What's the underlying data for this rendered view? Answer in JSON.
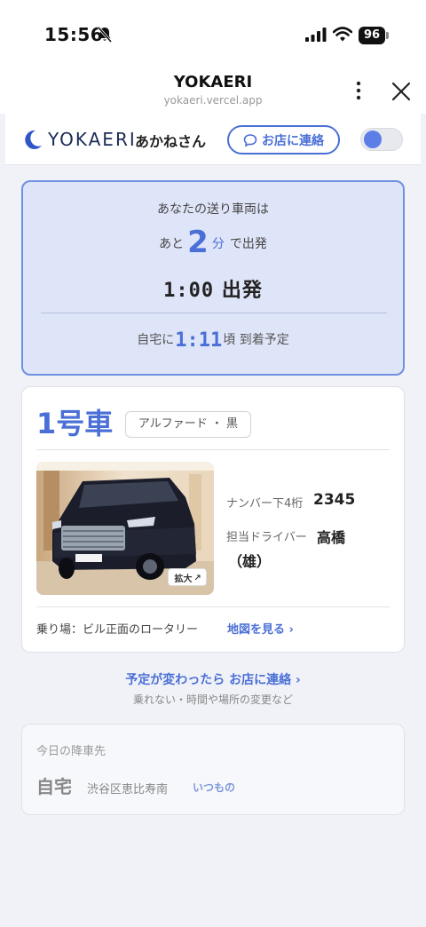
{
  "status_bar": {
    "time": "15:56",
    "battery": "96",
    "icons": [
      "bell-slash-icon",
      "signal-icon",
      "wifi-icon",
      "battery-icon"
    ]
  },
  "browser": {
    "title": "YOKAERI",
    "url": "yokaeri.vercel.app",
    "icons": [
      "more-vertical-icon",
      "close-icon"
    ]
  },
  "header": {
    "logo_text": "YOKAERI",
    "user_name": "あかねさん",
    "contact_label": "お店に連絡",
    "icons": [
      "moon-logo-icon",
      "chat-bubble-icon"
    ],
    "toggle_on": true
  },
  "departure": {
    "heading": "あなたの送り車両は",
    "prefix": "あと",
    "minutes": "2",
    "unit": "分",
    "suffix": "で出発",
    "depart_time": "1:00",
    "depart_label": "出発",
    "arrival_prefix": "自宅に",
    "arrival_time": "1:11",
    "arrival_suffix": "頃 到着予定"
  },
  "vehicle": {
    "car_number": "1号車",
    "model": "アルファード ・ 黒",
    "zoom_label": "拡大",
    "plate_label": "ナンバー下4桁",
    "plate_value": "2345",
    "driver_label": "担当ドライバー",
    "driver_name": "高橋（雄）",
    "pickup_label": "乗り場：ビル正面のロータリー",
    "map_link": "地図を見る ›",
    "photo": "black-minivan-photo"
  },
  "change": {
    "link": "予定が変わったら お店に連絡 ›",
    "sub": "乗れない・時間や場所の変更など"
  },
  "dropoff": {
    "heading": "今日の降車先",
    "place": "自宅",
    "address": "渋谷区恵比寿南",
    "badge": "いつもの"
  },
  "colors": {
    "accent": "#4a6fd6",
    "card_highlight": "#dfe5f8",
    "page_bg": "#f1f2f7"
  }
}
